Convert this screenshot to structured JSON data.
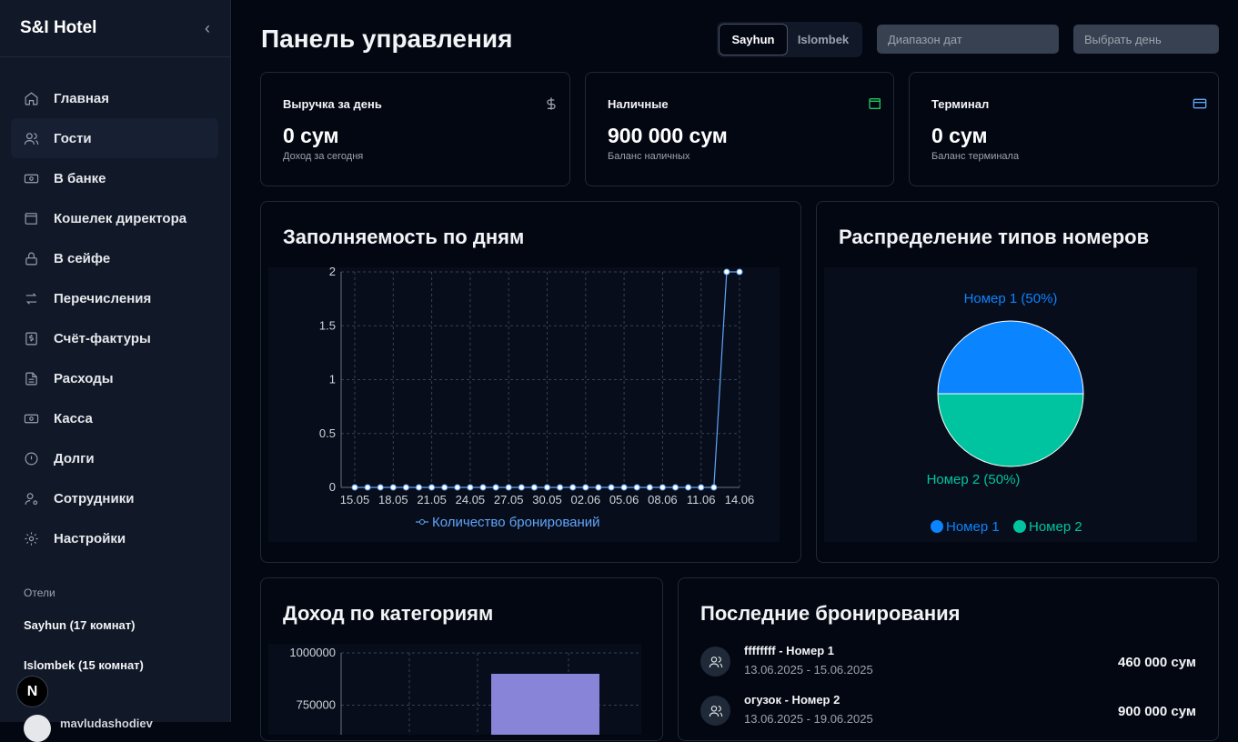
{
  "sidebar": {
    "brand": "S&I Hotel",
    "items": [
      {
        "label": "Главная",
        "icon": "home-icon"
      },
      {
        "label": "Гости",
        "icon": "users-icon"
      },
      {
        "label": "В банке",
        "icon": "banknote-icon"
      },
      {
        "label": "Кошелек директора",
        "icon": "wallet-icon"
      },
      {
        "label": "В сейфе",
        "icon": "lock-icon"
      },
      {
        "label": "Перечисления",
        "icon": "transfer-icon"
      },
      {
        "label": "Счёт-фактуры",
        "icon": "invoice-icon"
      },
      {
        "label": "Расходы",
        "icon": "document-icon"
      },
      {
        "label": "Касса",
        "icon": "cash-icon"
      },
      {
        "label": "Долги",
        "icon": "alert-circle-icon"
      },
      {
        "label": "Сотрудники",
        "icon": "staff-icon"
      },
      {
        "label": "Настройки",
        "icon": "gear-icon"
      }
    ],
    "active_index": 1,
    "hotels_title": "Отели",
    "hotels": [
      "Sayhun (17 комнат)",
      "Islombek (15 комнат)"
    ],
    "badge": "N",
    "user_name": "mavludashodiev"
  },
  "header": {
    "title": "Панель управления",
    "tabs": [
      "Sayhun",
      "Islombek"
    ],
    "selected_tab": "Sayhun",
    "date_range_placeholder": "Диапазон дат",
    "day_placeholder": "Выбрать день"
  },
  "stats": [
    {
      "label": "Выручка за день",
      "value": "0 сум",
      "sub": "Доход за сегодня",
      "icon": "dollar-icon",
      "icon_color": "#9ca3af"
    },
    {
      "label": "Наличные",
      "value": "900 000 сум",
      "sub": "Баланс наличных",
      "icon": "wallet-icon",
      "icon_color": "#22c55e"
    },
    {
      "label": "Терминал",
      "value": "0 сум",
      "sub": "Баланс терминала",
      "icon": "credit-card-icon",
      "icon_color": "#60a5fa"
    }
  ],
  "occupancy": {
    "title": "Заполняемость по дням",
    "chart_data": {
      "type": "line",
      "x": [
        "15.05",
        "16.05",
        "17.05",
        "18.05",
        "19.05",
        "20.05",
        "21.05",
        "22.05",
        "23.05",
        "24.05",
        "25.05",
        "26.05",
        "27.05",
        "28.05",
        "29.05",
        "30.05",
        "31.05",
        "01.06",
        "02.06",
        "03.06",
        "04.06",
        "05.06",
        "06.06",
        "07.06",
        "08.06",
        "09.06",
        "10.06",
        "11.06",
        "12.06",
        "13.06",
        "14.06"
      ],
      "tick_labels": [
        "15.05",
        "18.05",
        "21.05",
        "24.05",
        "27.05",
        "30.05",
        "02.06",
        "05.06",
        "08.06",
        "11.06",
        "14.06"
      ],
      "series": [
        {
          "name": "Количество бронирований",
          "values": [
            0,
            0,
            0,
            0,
            0,
            0,
            0,
            0,
            0,
            0,
            0,
            0,
            0,
            0,
            0,
            0,
            0,
            0,
            0,
            0,
            0,
            0,
            0,
            0,
            0,
            0,
            0,
            0,
            0,
            2,
            2
          ],
          "color": "#60a5fa"
        }
      ],
      "y_ticks": [
        "0",
        "0.5",
        "1",
        "1.5",
        "2"
      ],
      "ylim": [
        0,
        2
      ],
      "grid": true,
      "legend": "bottom"
    }
  },
  "room_types": {
    "title": "Распределение типов номеров",
    "chart_data": {
      "type": "pie",
      "slices": [
        {
          "name": "Номер 1",
          "value": 50,
          "label": "Номер 1 (50%)",
          "color": "#0a84ff"
        },
        {
          "name": "Номер 2",
          "value": 50,
          "label": "Номер 2 (50%)",
          "color": "#00c49f"
        }
      ],
      "legend": "bottom"
    }
  },
  "income": {
    "title": "Доход по категориям",
    "chart_data": {
      "type": "bar",
      "y_ticks": [
        "1000000",
        "750000"
      ],
      "values": [
        900000
      ],
      "ylim": [
        0,
        1000000
      ],
      "bar_color": "#8884d8",
      "grid": true
    }
  },
  "bookings": {
    "title": "Последние бронирования",
    "items": [
      {
        "title": "ffffffff - Номер 1",
        "dates": "13.06.2025 - 15.06.2025",
        "amount": "460 000 сум"
      },
      {
        "title": "огузок - Номер 2",
        "dates": "13.06.2025 - 19.06.2025",
        "amount": "900 000 сум"
      }
    ]
  }
}
